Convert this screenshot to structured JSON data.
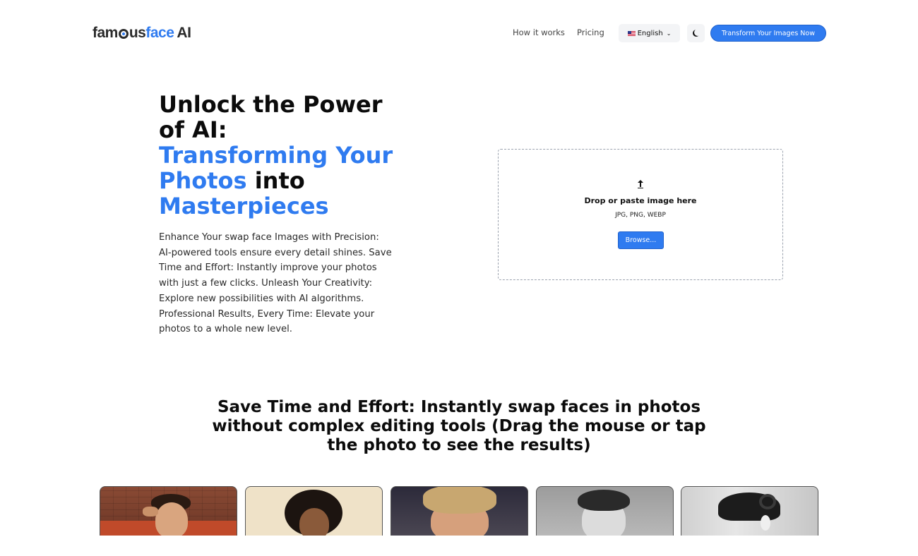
{
  "header": {
    "logo": {
      "part1": "fam",
      "part2": "us",
      "part3": "face",
      "part4": "AI"
    },
    "nav": {
      "how_it_works": "How it works",
      "pricing": "Pricing"
    },
    "language": {
      "selected": "English"
    },
    "cta_label": "Transform Your Images Now"
  },
  "hero": {
    "title": {
      "line1": "Unlock the Power of AI:",
      "highlight": "Transforming Your Photos",
      "middle": "into",
      "highlight2": "Masterpieces"
    },
    "description": "Enhance Your swap face Images with Precision: AI-powered tools ensure every detail shines. Save Time and Effort: Instantly improve your photos with just a few clicks. Unleash Your Creativity: Explore new possibilities with AI algorithms. Professional Results, Every Time: Elevate your photos to a whole new level."
  },
  "upload": {
    "icon": "upload-icon",
    "title": "Drop or paste image here",
    "formats": "JPG, PNG, WEBP",
    "browse_label": "Browse..."
  },
  "showcase": {
    "title": "Save Time and Effort: Instantly swap faces in photos without complex editing tools (Drag the mouse or tap the photo to see the results)"
  },
  "colors": {
    "accent": "#2f7bf0",
    "text": "#0b0b0b",
    "muted_bg": "#f3f4f6"
  }
}
